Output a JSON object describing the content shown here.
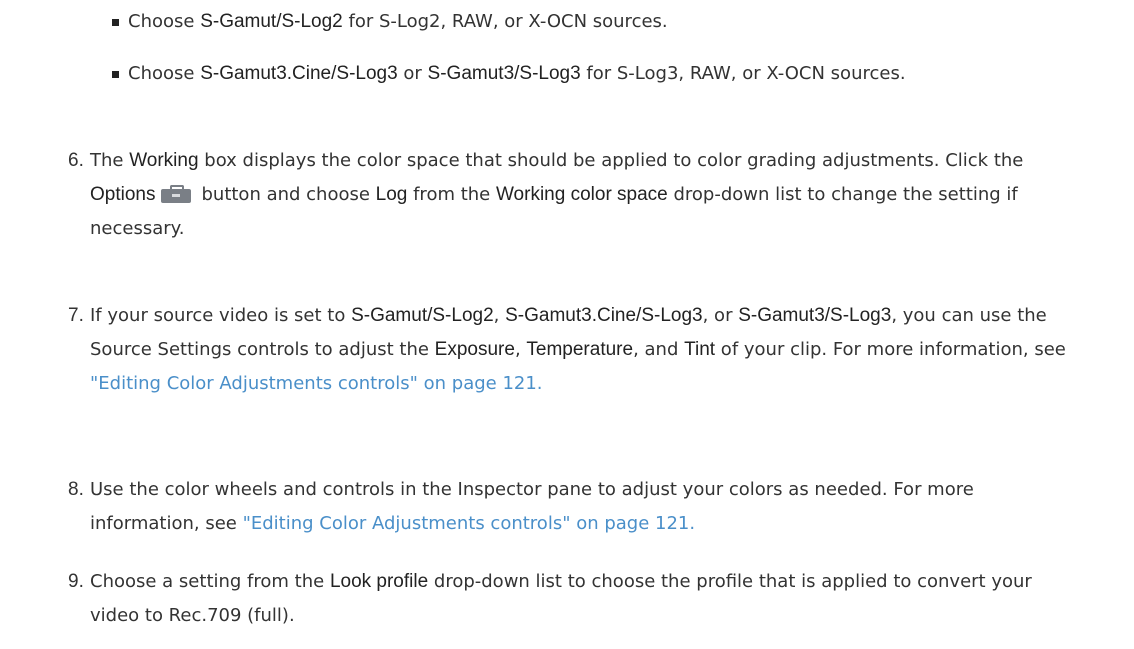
{
  "bullets": [
    {
      "p1": "Choose ",
      "ui1": "S-Gamut/S-Log2",
      "p2": " for S-Log2, RAW, or X-OCN sources."
    },
    {
      "p1": "Choose ",
      "ui1": "S-Gamut3.Cine/S-Log3",
      "p2": " or ",
      "ui2": "S-Gamut3/S-Log3",
      "p3": " for S-Log3, RAW, or X-OCN sources."
    }
  ],
  "steps": {
    "s6": {
      "num": "6.",
      "p1": "The ",
      "ui1": "Working",
      "p2": " box displays the color space that should be applied to color grading adjustments. Click the ",
      "ui2": "Options",
      "icon": "toolbox-icon",
      "p3": "button and choose ",
      "ui3": "Log",
      "p4": " from the ",
      "ui4": "Working color space",
      "p5": " drop-down list to change the setting if necessary."
    },
    "s7": {
      "num": "7.",
      "p1": "If your source video is set to ",
      "ui1": "S-Gamut/S-Log2",
      "p2": ", ",
      "ui2": "S-Gamut3.Cine/S-Log3",
      "p3": ", or ",
      "ui3": "S-Gamut3/S-Log3",
      "p4": ", you can use the Source Settings controls to adjust the ",
      "ui4": "Exposure",
      "p5": ", ",
      "ui5": "Temperature",
      "p6": ", and ",
      "ui6": "Tint",
      "p7": " of your clip. For more information, see ",
      "link": "\"Editing Color Adjustments controls\" on page 121."
    },
    "s8": {
      "num": "8.",
      "p1": "Use the color wheels and controls in the Inspector pane to adjust your colors as needed. For more information, see ",
      "link": "\"Editing Color Adjustments controls\" on page 121."
    },
    "s9": {
      "num": "9.",
      "p1": "Choose a setting from the ",
      "ui1": "Look profile",
      "p2": " drop-down list to choose the profile that is applied to convert your video to Rec.709 (full)."
    }
  },
  "colors": {
    "text": "#333333",
    "ui_term": "#222222",
    "link": "#4a8fc9",
    "icon": "#7a7f86"
  }
}
